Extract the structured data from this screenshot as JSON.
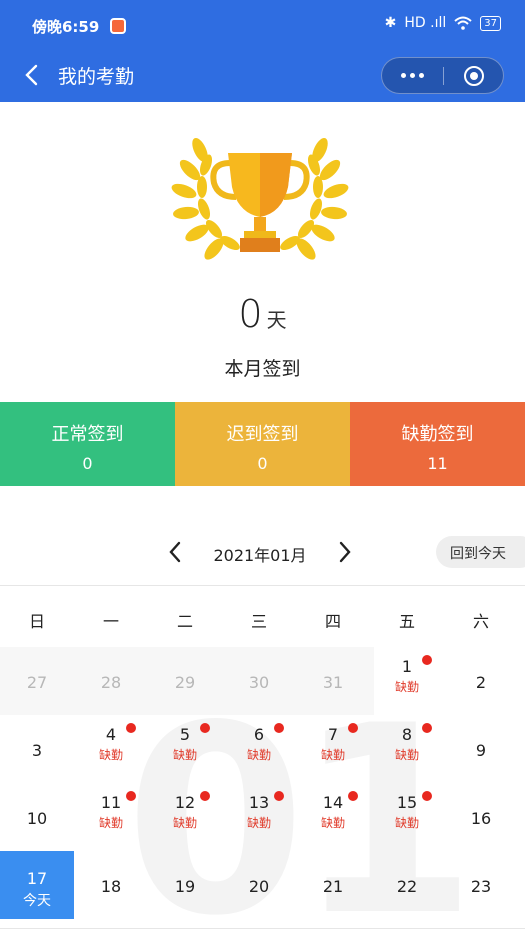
{
  "status_bar": {
    "time": "傍晚6:59",
    "bluetooth": "✱",
    "signal": "HD .ıll",
    "wifi": "wifi",
    "battery": "37"
  },
  "nav": {
    "title": "我的考勤"
  },
  "summary": {
    "days": "0",
    "unit": "天",
    "label": "本月签到"
  },
  "stats": [
    {
      "label": "正常签到",
      "value": "0",
      "color": "#33c07f"
    },
    {
      "label": "迟到签到",
      "value": "0",
      "color": "#ecb43b"
    },
    {
      "label": "缺勤签到",
      "value": "11",
      "color": "#ec6a3c"
    }
  ],
  "calendar": {
    "month": "2021年01月",
    "today_button": "回到今天",
    "watermark": "01",
    "weekdays": [
      "日",
      "一",
      "二",
      "三",
      "四",
      "五",
      "六"
    ],
    "weeks": [
      [
        {
          "day": "27",
          "muted": true
        },
        {
          "day": "28",
          "muted": true
        },
        {
          "day": "29",
          "muted": true
        },
        {
          "day": "30",
          "muted": true
        },
        {
          "day": "31",
          "muted": true
        },
        {
          "day": "1",
          "tag": "缺勤",
          "dot": true
        },
        {
          "day": "2"
        }
      ],
      [
        {
          "day": "3"
        },
        {
          "day": "4",
          "tag": "缺勤",
          "dot": true
        },
        {
          "day": "5",
          "tag": "缺勤",
          "dot": true
        },
        {
          "day": "6",
          "tag": "缺勤",
          "dot": true
        },
        {
          "day": "7",
          "tag": "缺勤",
          "dot": true
        },
        {
          "day": "8",
          "tag": "缺勤",
          "dot": true
        },
        {
          "day": "9"
        }
      ],
      [
        {
          "day": "10"
        },
        {
          "day": "11",
          "tag": "缺勤",
          "dot": true
        },
        {
          "day": "12",
          "tag": "缺勤",
          "dot": true
        },
        {
          "day": "13",
          "tag": "缺勤",
          "dot": true
        },
        {
          "day": "14",
          "tag": "缺勤",
          "dot": true
        },
        {
          "day": "15",
          "tag": "缺勤",
          "dot": true
        },
        {
          "day": "16"
        }
      ],
      [
        {
          "day": "17",
          "tag": "今天",
          "today": true
        },
        {
          "day": "18"
        },
        {
          "day": "19"
        },
        {
          "day": "20"
        },
        {
          "day": "21"
        },
        {
          "day": "22"
        },
        {
          "day": "23"
        }
      ]
    ]
  }
}
